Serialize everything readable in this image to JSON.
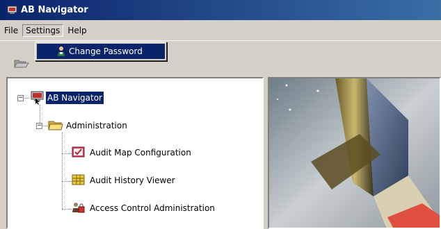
{
  "window": {
    "title": "AB Navigator"
  },
  "menubar": {
    "items": [
      "File",
      "Settings",
      "Help"
    ]
  },
  "settings_menu": {
    "items": [
      "Change Password"
    ]
  },
  "tree": {
    "root": "AB Navigator",
    "folder": "Administration",
    "children": [
      "Audit Map Configuration",
      "Audit History Viewer",
      "Access Control Administration"
    ]
  },
  "colors": {
    "selection": "#0a246a",
    "face": "#d4d0c8",
    "titlebar": "#0a246a"
  },
  "icons": {
    "window": "app-icon",
    "toolbar": "open-folder-icon",
    "menu_item": "user-key-icon",
    "root": "computer-icon",
    "folder": "folder-icon",
    "child1": "map-config-icon",
    "child2": "history-icon",
    "child3": "access-control-icon"
  }
}
